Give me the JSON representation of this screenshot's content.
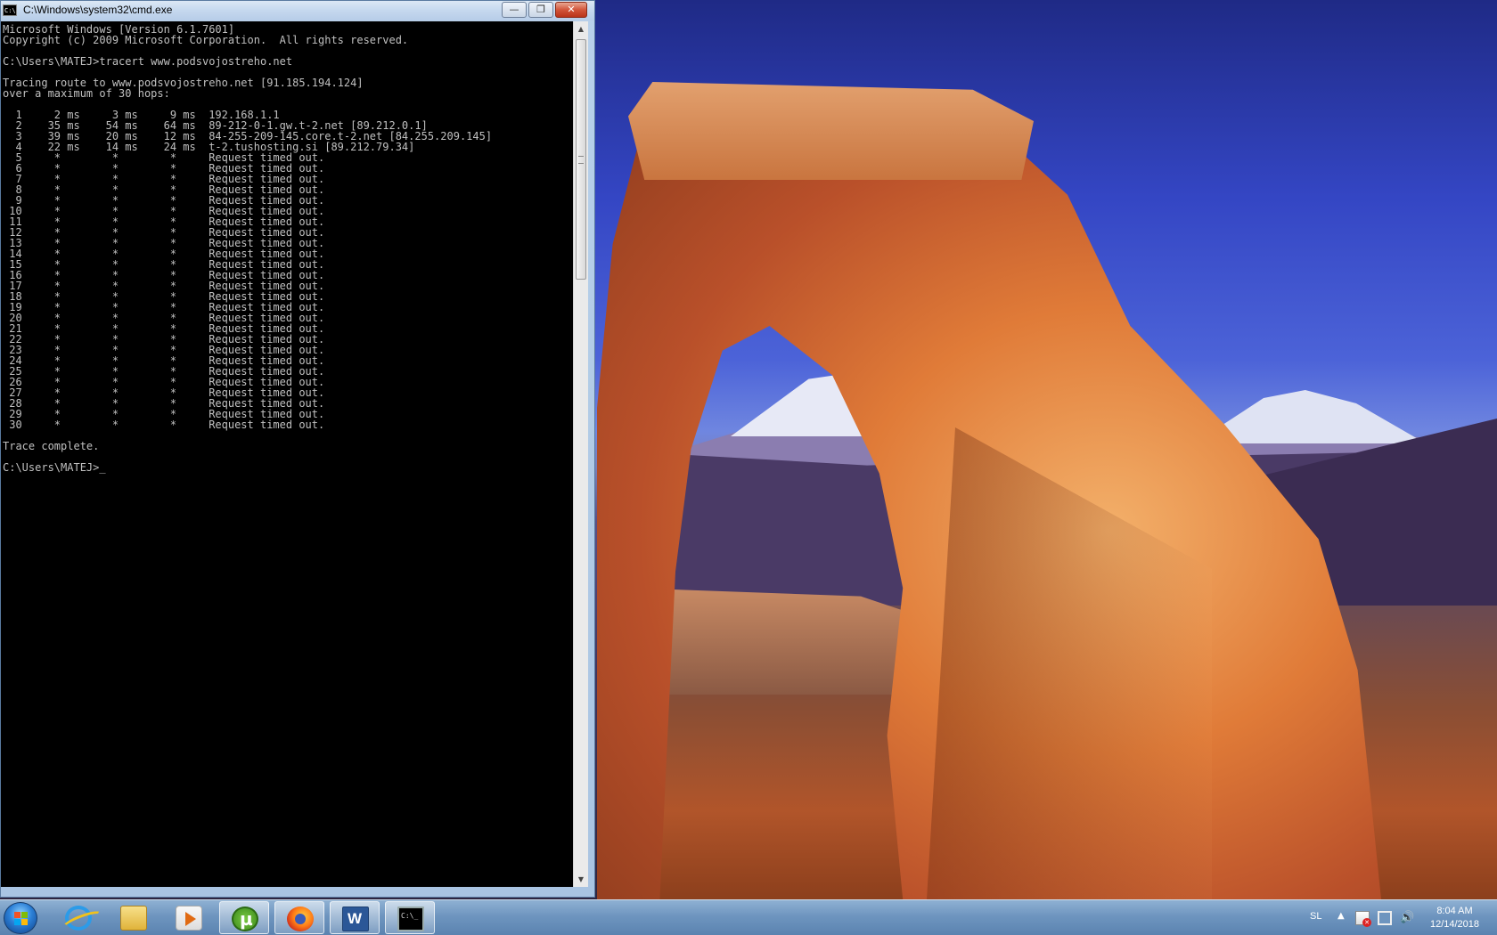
{
  "window": {
    "title": "C:\\Windows\\system32\\cmd.exe",
    "controls": {
      "minimize": "—",
      "maximize": "❐",
      "close": "✕"
    }
  },
  "console": {
    "lines": [
      "Microsoft Windows [Version 6.1.7601]",
      "Copyright (c) 2009 Microsoft Corporation.  All rights reserved.",
      "",
      "C:\\Users\\MATEJ>tracert www.podsvojostreho.net",
      "",
      "Tracing route to www.podsvojostreho.net [91.185.194.124]",
      "over a maximum of 30 hops:",
      "",
      "  1     2 ms     3 ms     9 ms  192.168.1.1",
      "  2    35 ms    54 ms    64 ms  89-212-0-1.gw.t-2.net [89.212.0.1]",
      "  3    39 ms    20 ms    12 ms  84-255-209-145.core.t-2.net [84.255.209.145]",
      "  4    22 ms    14 ms    24 ms  t-2.tushosting.si [89.212.79.34]",
      "  5     *        *        *     Request timed out.",
      "  6     *        *        *     Request timed out.",
      "  7     *        *        *     Request timed out.",
      "  8     *        *        *     Request timed out.",
      "  9     *        *        *     Request timed out.",
      " 10     *        *        *     Request timed out.",
      " 11     *        *        *     Request timed out.",
      " 12     *        *        *     Request timed out.",
      " 13     *        *        *     Request timed out.",
      " 14     *        *        *     Request timed out.",
      " 15     *        *        *     Request timed out.",
      " 16     *        *        *     Request timed out.",
      " 17     *        *        *     Request timed out.",
      " 18     *        *        *     Request timed out.",
      " 19     *        *        *     Request timed out.",
      " 20     *        *        *     Request timed out.",
      " 21     *        *        *     Request timed out.",
      " 22     *        *        *     Request timed out.",
      " 23     *        *        *     Request timed out.",
      " 24     *        *        *     Request timed out.",
      " 25     *        *        *     Request timed out.",
      " 26     *        *        *     Request timed out.",
      " 27     *        *        *     Request timed out.",
      " 28     *        *        *     Request timed out.",
      " 29     *        *        *     Request timed out.",
      " 30     *        *        *     Request timed out.",
      "",
      "Trace complete.",
      "",
      "C:\\Users\\MATEJ>_"
    ]
  },
  "taskbar": {
    "items": [
      {
        "name": "internet-explorer",
        "icon": "ie-icon",
        "active": false
      },
      {
        "name": "windows-explorer",
        "icon": "folder-icon",
        "active": false
      },
      {
        "name": "media-player",
        "icon": "media-icon",
        "active": false
      },
      {
        "name": "utorrent",
        "icon": "utorrent-icon",
        "active": true
      },
      {
        "name": "firefox",
        "icon": "firefox-icon",
        "active": true
      },
      {
        "name": "word",
        "icon": "word-icon",
        "active": true
      },
      {
        "name": "command-prompt",
        "icon": "cmd-icon",
        "active": true
      }
    ],
    "tray": {
      "language": "SL",
      "time": "8:04 AM",
      "date": "12/14/2018"
    }
  },
  "colors": {
    "console_bg": "#000000",
    "console_text": "#c0c0c0",
    "close_button": "#c8462b",
    "taskbar": "#6e95bf"
  }
}
